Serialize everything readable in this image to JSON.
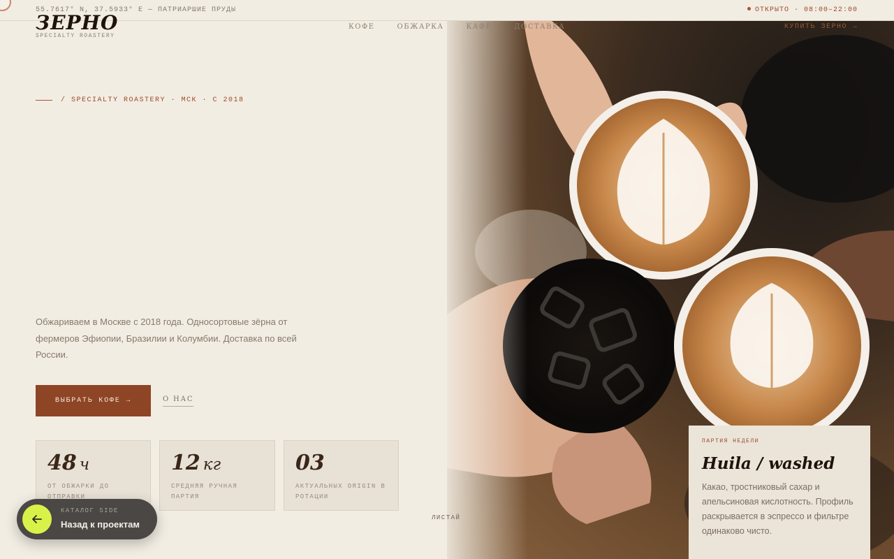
{
  "topbar": {
    "coords": "55.7617° N, 37.5933° E — ПАТРИАРШИЕ ПРУДЫ",
    "status_open": "ОТКРЫТО",
    "hours": "· 08:00–22:00"
  },
  "brand": {
    "logo": "ЗЕРНО",
    "tagline": "SPECIALTY ROASTERY"
  },
  "nav": {
    "items": [
      "КОФЕ",
      "ОБЖАРКА",
      "КАФЕ",
      "ДОСТАВКА"
    ],
    "cta": "КУПИТЬ ЗЕРНО →"
  },
  "hero": {
    "breadcrumb": "/ SPECIALTY ROASTERY · МСК · С 2018",
    "lead": "Обжариваем в Москве с 2018 года. Односортовые зёрна от фермеров Эфиопии, Бразилии и Колумбии. Доставка по всей России.",
    "primary_button": "ВЫБРАТЬ КОФЕ →",
    "secondary_link": "О НАС",
    "swipe_hint": "ЛИСТАЙ"
  },
  "stats": [
    {
      "value": "48",
      "unit": "ч",
      "label": "ОТ ОБЖАРКИ ДО ОТПРАВКИ"
    },
    {
      "value": "12",
      "unit": "кг",
      "label": "СРЕДНЯЯ РУЧНАЯ ПАРТИЯ"
    },
    {
      "value": "03",
      "unit": "",
      "label": "АКТУАЛЬНЫХ ORIGIN В РОТАЦИИ"
    }
  ],
  "feature": {
    "tag": "ПАРТИЯ НЕДЕЛИ",
    "title": "Huila / washed",
    "description": "Какао, тростниковый сахар и апельсиновая кислотность. Профиль раскрывается в эспрессо и фильтре одинаково чисто."
  },
  "back_pill": {
    "caption": "КАТАЛОГ SIDE",
    "label": "Назад к проектам",
    "icon": "arrow-left-icon"
  },
  "colors": {
    "background": "#f2ede3",
    "accent": "#8e4526",
    "pill_accent": "#d9f24a"
  }
}
